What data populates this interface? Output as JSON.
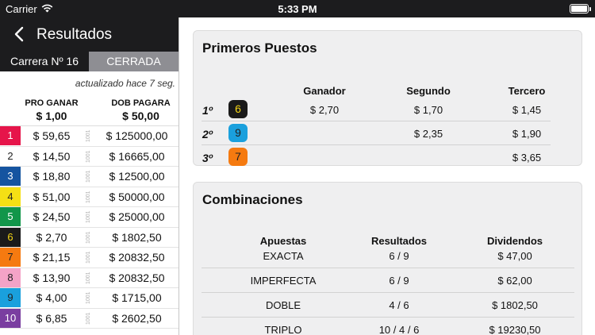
{
  "status_bar": {
    "carrier": "Carrier",
    "time": "5:33 PM"
  },
  "nav": {
    "title": "Resultados"
  },
  "race": {
    "label": "Carrera Nº 16",
    "state": "CERRADA"
  },
  "updated": "actualizado hace 7 seg.",
  "columns": {
    "win_header": "PRO GANAR",
    "win_base": "$ 1,00",
    "dob_header": "DOB PAGARA",
    "dob_base": "$ 50,00"
  },
  "runners": [
    {
      "num": "1",
      "bg": "#e6154a",
      "fg": "#ffffff",
      "win": "$ 59,65",
      "tag": "1001",
      "dob": "$ 125000,00"
    },
    {
      "num": "2",
      "bg": "#ffffff",
      "fg": "#222222",
      "win": "$ 14,50",
      "tag": "1001",
      "dob": "$ 16665,00"
    },
    {
      "num": "3",
      "bg": "#1554a0",
      "fg": "#ffffff",
      "win": "$ 18,80",
      "tag": "1001",
      "dob": "$ 12500,00"
    },
    {
      "num": "4",
      "bg": "#f5e015",
      "fg": "#222222",
      "win": "$ 51,00",
      "tag": "1001",
      "dob": "$ 50000,00"
    },
    {
      "num": "5",
      "bg": "#11964a",
      "fg": "#ffffff",
      "win": "$ 24,50",
      "tag": "1001",
      "dob": "$ 25000,00"
    },
    {
      "num": "6",
      "bg": "#1a1a1a",
      "fg": "#f5d615",
      "win": "$ 2,70",
      "tag": "1001",
      "dob": "$ 1802,50"
    },
    {
      "num": "7",
      "bg": "#f57a10",
      "fg": "#222222",
      "win": "$ 21,15",
      "tag": "1001",
      "dob": "$ 20832,50"
    },
    {
      "num": "8",
      "bg": "#f4a3c7",
      "fg": "#222222",
      "win": "$ 13,90",
      "tag": "1001",
      "dob": "$ 20832,50"
    },
    {
      "num": "9",
      "bg": "#1aa0dd",
      "fg": "#222222",
      "win": "$ 4,00",
      "tag": "1001",
      "dob": "$ 1715,00"
    },
    {
      "num": "10",
      "bg": "#7a3ea0",
      "fg": "#ffffff",
      "win": "$ 6,85",
      "tag": "1001",
      "dob": "$ 2602,50"
    }
  ],
  "primeros": {
    "title": "Primeros Puestos",
    "headers": [
      "Ganador",
      "Segundo",
      "Tercero"
    ],
    "rows": [
      {
        "pos": "1º",
        "num": "6",
        "bg": "#1a1a1a",
        "fg": "#f5d615",
        "vals": [
          "$ 2,70",
          "$ 1,70",
          "$ 1,45"
        ]
      },
      {
        "pos": "2º",
        "num": "9",
        "bg": "#1aa0dd",
        "fg": "#222222",
        "vals": [
          "",
          "$ 2,35",
          "$ 1,90"
        ]
      },
      {
        "pos": "3º",
        "num": "7",
        "bg": "#f57a10",
        "fg": "#222222",
        "vals": [
          "",
          "",
          "$ 3,65"
        ]
      }
    ]
  },
  "combinaciones": {
    "title": "Combinaciones",
    "headers": [
      "Apuestas",
      "Resultados",
      "Dividendos"
    ],
    "rows": [
      [
        "EXACTA",
        "6 / 9",
        "$ 47,00"
      ],
      [
        "IMPERFECTA",
        "6 / 9",
        "$ 62,00"
      ],
      [
        "DOBLE",
        "4 / 6",
        "$ 1802,50"
      ],
      [
        "TRIPLO",
        "10 / 4 / 6",
        "$ 19230,50"
      ]
    ]
  }
}
